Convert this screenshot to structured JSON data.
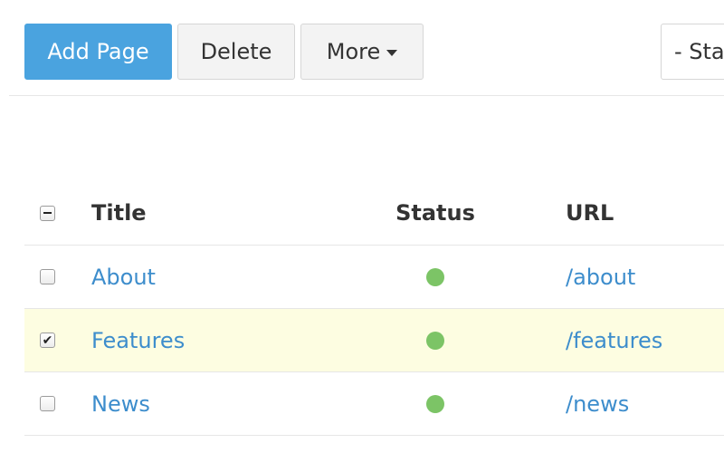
{
  "toolbar": {
    "add_label": "Add Page",
    "delete_label": "Delete",
    "more_label": "More",
    "status_filter": "- Status -"
  },
  "table": {
    "columns": [
      "Title",
      "Status",
      "URL"
    ],
    "select_all": "indeterminate",
    "rows": [
      {
        "title": "About",
        "status": "published",
        "status_color": "#7cc466",
        "url": "/about",
        "checked": false
      },
      {
        "title": "Features",
        "status": "published",
        "status_color": "#7cc466",
        "url": "/features",
        "checked": true
      },
      {
        "title": "News",
        "status": "published",
        "status_color": "#7cc466",
        "url": "/news",
        "checked": false
      }
    ]
  },
  "colors": {
    "primary": "#4aa3df",
    "link": "#3d8dcc",
    "selected_row": "#fdfde1",
    "status_ok": "#7cc466"
  }
}
